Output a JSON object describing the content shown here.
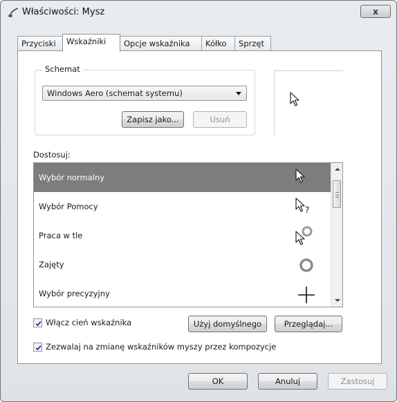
{
  "window": {
    "title": "Właściwości: Mysz",
    "close_glyph": "x"
  },
  "tabs": [
    {
      "label": "Przyciski",
      "active": false
    },
    {
      "label": "Wskaźniki",
      "active": true
    },
    {
      "label": "Opcje wskaźnika",
      "active": false
    },
    {
      "label": "Kółko",
      "active": false
    },
    {
      "label": "Sprzęt",
      "active": false
    }
  ],
  "scheme": {
    "group_label": "Schemat",
    "selected": "Windows Aero (schemat systemu)",
    "save_as_label": "Zapisz jako...",
    "delete_label": "Usuń"
  },
  "customize": {
    "label": "Dostosuj:",
    "items": [
      {
        "label": "Wybór normalny",
        "cursor": "arrow-cursor-icon",
        "selected": true
      },
      {
        "label": "Wybór Pomocy",
        "cursor": "help-cursor-icon",
        "selected": false
      },
      {
        "label": "Praca w tle",
        "cursor": "working-in-background-cursor-icon",
        "selected": false
      },
      {
        "label": "Zajęty",
        "cursor": "busy-cursor-icon",
        "selected": false
      },
      {
        "label": "Wybór precyzyjny",
        "cursor": "crosshair-cursor-icon",
        "selected": false
      }
    ]
  },
  "options": {
    "shadow_label": "Włącz cień wskaźnika",
    "shadow_checked": true,
    "use_default_label": "Użyj domyślnego",
    "browse_label": "Przeglądaj...",
    "themes_label": "Zezwalaj na zmianę wskaźników myszy przez kompozycje",
    "themes_checked": true
  },
  "footer": {
    "ok_label": "OK",
    "cancel_label": "Anuluj",
    "apply_label": "Zastosuj"
  },
  "colors": {
    "selection": "#7d7d7d",
    "border": "#8d939b"
  }
}
